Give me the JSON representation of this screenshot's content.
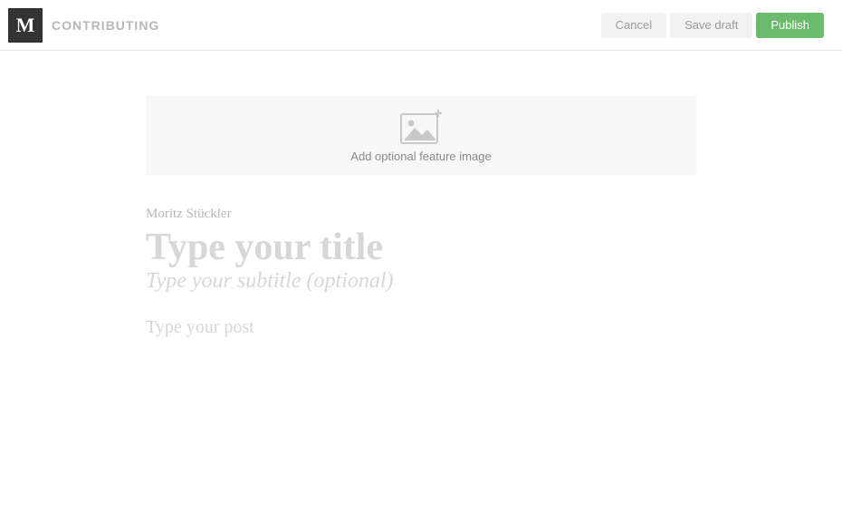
{
  "header": {
    "logo_text": "M",
    "context_label": "CONTRIBUTING",
    "cancel_label": "Cancel",
    "save_draft_label": "Save draft",
    "publish_label": "Publish"
  },
  "editor": {
    "feature_image_label": "Add optional feature image",
    "author_name": "Moritz Stückler",
    "title_value": "",
    "title_placeholder": "Type your title",
    "subtitle_value": "",
    "subtitle_placeholder": "Type your subtitle (optional)",
    "body_value": "",
    "body_placeholder": "Type your post"
  },
  "icons": {
    "image_add": "image-add-icon"
  }
}
